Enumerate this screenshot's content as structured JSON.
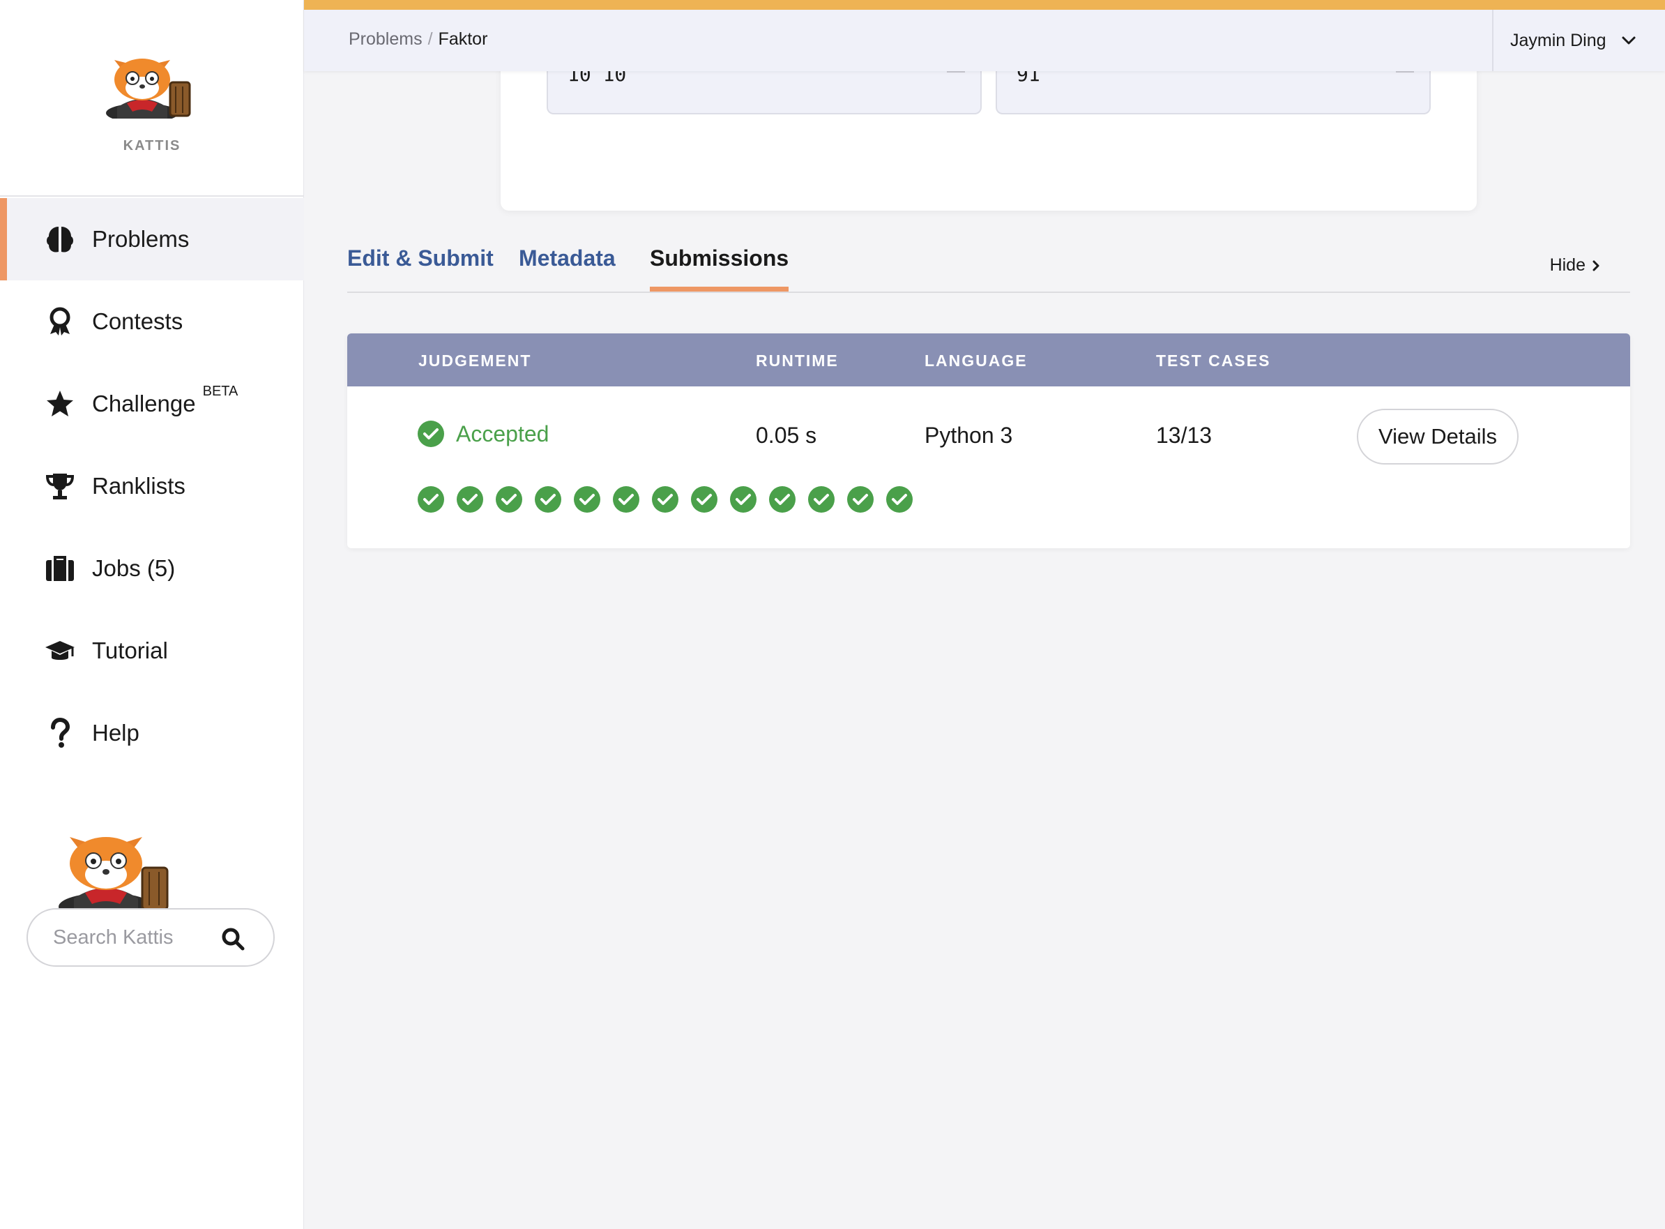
{
  "sidebar": {
    "logo_text": "KATTIS",
    "nav": [
      {
        "label": "Problems",
        "icon": "brain-icon",
        "active": true
      },
      {
        "label": "Contests",
        "icon": "award-icon"
      },
      {
        "label": "Challenge",
        "icon": "star-icon",
        "sup": "BETA"
      },
      {
        "label": "Ranklists",
        "icon": "trophy-icon"
      },
      {
        "label": "Jobs (5)",
        "icon": "briefcase-icon"
      },
      {
        "label": "Tutorial",
        "icon": "graduation-cap-icon"
      },
      {
        "label": "Help",
        "icon": "question-icon"
      }
    ],
    "search": {
      "placeholder": "Search Kattis",
      "value": ""
    }
  },
  "header": {
    "breadcrumb": {
      "parent": "Problems",
      "separator": "/",
      "current": "Faktor"
    },
    "user_name": "Jaymin Ding"
  },
  "sample": {
    "input": "10 10",
    "output": "91"
  },
  "tabs": [
    {
      "label": "Edit & Submit",
      "active": false
    },
    {
      "label": "Metadata",
      "active": false
    },
    {
      "label": "Submissions",
      "active": true
    }
  ],
  "hide_label": "Hide",
  "submissions": {
    "headers": {
      "judgement": "JUDGEMENT",
      "runtime": "RUNTIME",
      "language": "LANGUAGE",
      "test_cases": "TEST CASES"
    },
    "row": {
      "judgement": "Accepted",
      "runtime": "0.05 s",
      "language": "Python 3",
      "test_cases": "13/13",
      "details_label": "View Details",
      "passed_cases": 13
    }
  },
  "colors": {
    "accent_orange": "#ee9764",
    "top_stripe": "#eeb354",
    "link_blue": "#3a5a96",
    "table_header": "#8990b4",
    "accepted_green": "#4aa04a"
  }
}
